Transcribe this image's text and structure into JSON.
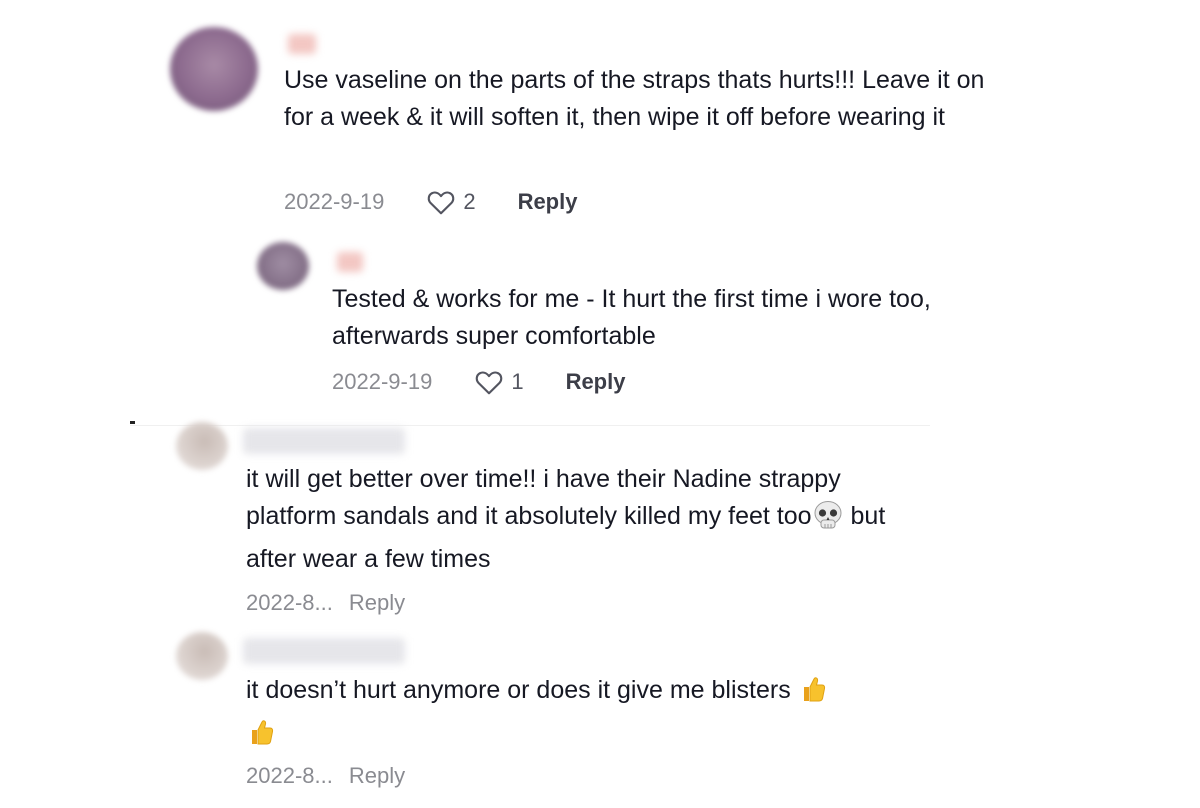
{
  "comments": [
    {
      "text": "Use vaseline on the parts of the straps thats hurts!!! Leave it on for a week & it will soften it, then wipe it off before wearing it",
      "date": "2022-9-19",
      "likes": "2",
      "reply_label": "Reply"
    },
    {
      "text": "Tested & works for me - It hurt the first time i wore too, afterwards super comfortable",
      "date": "2022-9-19",
      "likes": "1",
      "reply_label": "Reply"
    },
    {
      "text_before_emoji": "it will get better over time!! i have their Nadine strappy platform sandals and it absolutely killed my feet too",
      "text_after_emoji": " but after wear a few times",
      "emoji_icon": "skull-emoji",
      "date": "2022-8...",
      "reply_label": "Reply"
    },
    {
      "text": "it doesn’t hurt anymore or does it give me blisters ",
      "emoji_icon": "thumbs-up-emoji",
      "date": "2022-8...",
      "reply_label": "Reply"
    }
  ],
  "colors": {
    "text": "#161823",
    "meta": "#8a8b91",
    "reply_strong": "#3c3e48"
  }
}
